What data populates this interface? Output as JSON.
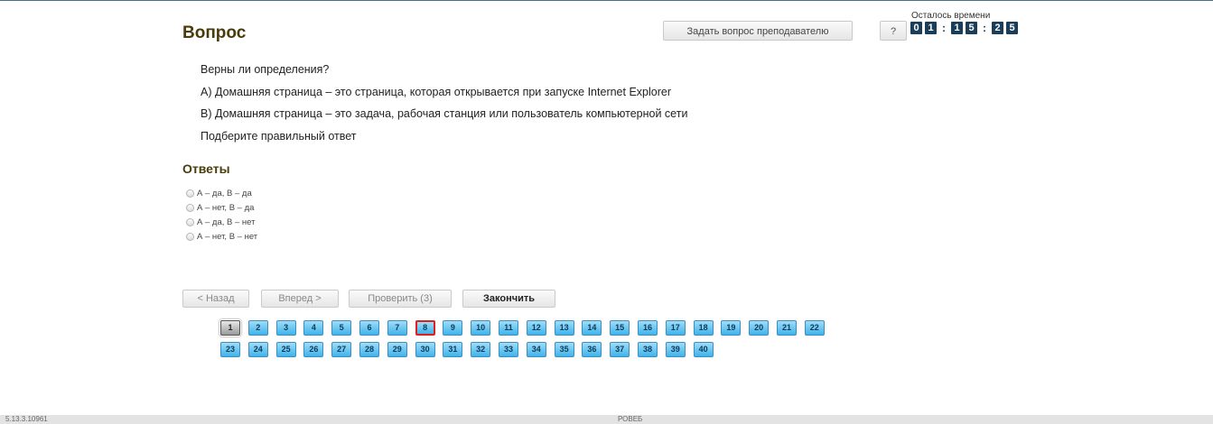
{
  "header": {
    "title": "Вопрос",
    "ask_teacher_label": "Задать вопрос преподавателю",
    "help_label": "?",
    "timer_label": "Осталось времени",
    "timer_digits": [
      "0",
      "1",
      "1",
      "5",
      "2",
      "5"
    ]
  },
  "question": {
    "lines": [
      "Верны ли определения?",
      "А) Домашняя страница – это страница, которая открывается при запуске Internet Explorer",
      "В) Домашняя страница – это задача, рабочая станция или пользователь компьютерной сети",
      "Подберите правильный ответ"
    ]
  },
  "answers": {
    "title": "Ответы",
    "options": [
      "А – да, В – да",
      "А – нет, В – да",
      "А – да, В – нет",
      "А – нет, В – нет"
    ]
  },
  "navigation": {
    "back_label": "< Назад",
    "forward_label": "Вперед >",
    "check_label": "Проверить (3)",
    "finish_label": "Закончить"
  },
  "question_grid": {
    "numbers": [
      "1",
      "2",
      "3",
      "4",
      "5",
      "6",
      "7",
      "8",
      "9",
      "10",
      "11",
      "12",
      "13",
      "14",
      "15",
      "16",
      "17",
      "18",
      "19",
      "20",
      "21",
      "22",
      "23",
      "24",
      "25",
      "26",
      "27",
      "28",
      "29",
      "30",
      "31",
      "32",
      "33",
      "34",
      "35",
      "36",
      "37",
      "38",
      "39",
      "40"
    ],
    "current": "1",
    "marked": "8"
  },
  "footer": {
    "version": "5.13.3.10961",
    "center_text": "РОВЕБ"
  }
}
